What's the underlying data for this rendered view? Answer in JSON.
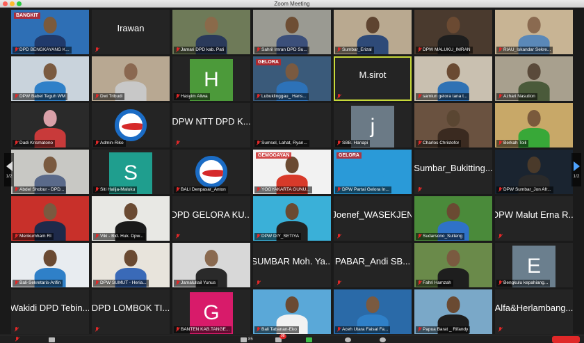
{
  "window": {
    "title": "Zoom Meeting"
  },
  "pager": {
    "left_page": "1/2",
    "right_page": "1/2"
  },
  "toolbar": {
    "participants_count": "85",
    "chat_badge": "98"
  },
  "tiles": [
    {
      "name": "DPD BENGKAYANG K...",
      "kind": "video",
      "bg": "#2e6fb5",
      "head": "#7a5a3c",
      "body": "#203a6b",
      "banner": "BANGKIT"
    },
    {
      "name": "",
      "kind": "text",
      "big": "Irawan"
    },
    {
      "name": "Jamari DPD kab. Pati",
      "kind": "video",
      "bg": "#6e7a58",
      "head": "#8a6a4a",
      "body": "#2a3a5a"
    },
    {
      "name": "Sahril Imran DPD Su...",
      "kind": "video",
      "bg": "#9a9a92",
      "head": "#6e4e34",
      "body": "#3b4f7a"
    },
    {
      "name": "Sumbar_Erizal",
      "kind": "video",
      "bg": "#b9a990",
      "head": "#5e4430",
      "body": "#2e4a78"
    },
    {
      "name": "DPW MALUKU_IMRAN",
      "kind": "video",
      "bg": "#4a3a2e",
      "head": "#6b4a32",
      "body": "#1e1e1e"
    },
    {
      "name": "RIAU_Iskandar Sekre...",
      "kind": "video",
      "bg": "#c8b494",
      "head": "#8a6a50",
      "body": "#5a88b8"
    },
    {
      "name": "DPW Babel Teguh WM",
      "kind": "video",
      "bg": "#c9d3dc",
      "head": "#7a5a40",
      "body": "#2f80c8"
    },
    {
      "name": "Dwi Tribudi",
      "kind": "video",
      "bg": "#b8a892",
      "head": "#8a6850",
      "body": "#c8c8c8"
    },
    {
      "name": "Hasyim Aliwa",
      "kind": "avatar",
      "avatar_letter": "H",
      "avatar_bg": "#4c9a3a"
    },
    {
      "name": "Lubuklinggau_ Hans...",
      "kind": "video",
      "bg": "#3a5a7a",
      "head": "#7a5a40",
      "body": "#2d72b8",
      "banner": "GELORA"
    },
    {
      "name": "",
      "kind": "text",
      "big": "M.sirot",
      "active": true
    },
    {
      "name": "samiun gelora tana t...",
      "kind": "video",
      "bg": "#c9c0b0",
      "head": "#6a4a32",
      "body": "#2f72b4"
    },
    {
      "name": "Azhari Nasution",
      "kind": "video",
      "bg": "#a8a08e",
      "head": "#5a4a3a",
      "body": "#4a5a3a"
    },
    {
      "name": "Dadi Krismatono",
      "kind": "video",
      "bg": "#2a2a2a",
      "head": "#d9a0a8",
      "body": "#c83a3a"
    },
    {
      "name": "Admin-Riko",
      "kind": "logo"
    },
    {
      "name": "",
      "kind": "text",
      "big": "DPW NTT DPD K..."
    },
    {
      "name": "Sumsel, Lahat, Ryan...",
      "kind": "blank"
    },
    {
      "name": "SBB. Hanapi",
      "kind": "avatar",
      "avatar_letter": "j",
      "avatar_bg": "#6b7a86"
    },
    {
      "name": "Charlos Christofor",
      "kind": "video",
      "bg": "#6a5240",
      "head": "#5a4632",
      "body": "#3a2a20"
    },
    {
      "name": "Berkah Toili",
      "kind": "video",
      "bg": "#c8a868",
      "head": "#7a5a3c",
      "body": "#38a838"
    },
    {
      "name": "Abdel Shobur - DPD...",
      "kind": "video",
      "bg": "#c8c8c4",
      "head": "#7a5a40",
      "body": "#5a6a8a"
    },
    {
      "name": "Siti Halija-Maluku",
      "kind": "avatar",
      "avatar_letter": "S",
      "avatar_bg": "#1f9e8e"
    },
    {
      "name": "BALI Denpasar_Anton",
      "kind": "logo"
    },
    {
      "name": "YOGYAKARTA GUNU...",
      "kind": "video",
      "bg": "#f2f2f2",
      "head": "#6a4a32",
      "body": "#d83a2a",
      "banner": "GEMOGAYAN"
    },
    {
      "name": "DPW Partai Gelora In...",
      "kind": "video",
      "bg": "#2a9ad8",
      "head": "#2a9ad8",
      "body": "#2a9ad8",
      "banner": "GELORA"
    },
    {
      "name": "",
      "kind": "text",
      "big": "Sumbar_Bukitting..."
    },
    {
      "name": "DPW Sumbar_Jon Afr...",
      "kind": "video",
      "bg": "#1a2430",
      "head": "#4a3a2a",
      "body": "#2a2a2a"
    },
    {
      "name": "Menkumham RI",
      "kind": "video",
      "bg": "#c8302a",
      "head": "#7a5a40",
      "body": "#1e2a4a"
    },
    {
      "name": "Viki - Bid. Huk. Dpw...",
      "kind": "video",
      "bg": "#e8e8e4",
      "head": "#6a4a32",
      "body": "#1a1a1a"
    },
    {
      "name": "",
      "kind": "text",
      "big": "DPD GELORA KU..."
    },
    {
      "name": "DPW DIY_SETIYA",
      "kind": "video",
      "bg": "#3ab0d8",
      "head": "#6a4a32",
      "body": "#222222"
    },
    {
      "name": "",
      "kind": "text",
      "big": "Joenef_WASEKJEN"
    },
    {
      "name": "Sudarsono_Sulteng",
      "kind": "video",
      "bg": "#4a8a3a",
      "head": "#6a4a32",
      "body": "#2f72c8"
    },
    {
      "name": "",
      "kind": "text",
      "big": "DPW Malut Erna R..."
    },
    {
      "name": "Bali-Sekretaris-Arifin",
      "kind": "video",
      "bg": "#e8ecf0",
      "head": "#6a4a32",
      "body": "#2f80c8"
    },
    {
      "name": "DPW SUMUT - Heria...",
      "kind": "video",
      "bg": "#e8e4dc",
      "head": "#6a4a32",
      "body": "#3a6ab8"
    },
    {
      "name": "Jamalullail Yunus",
      "kind": "video",
      "bg": "#d8d8d8",
      "head": "#8a6a50",
      "body": "#2a2a2a"
    },
    {
      "name": "",
      "kind": "text",
      "big": "SUMBAR Moh. Ya..."
    },
    {
      "name": "",
      "kind": "text",
      "big": "PABAR_Andi SB..."
    },
    {
      "name": "Fahri Hamzah",
      "kind": "video",
      "bg": "#6a8a4a",
      "head": "#7a5a40",
      "body": "#1e1e1e"
    },
    {
      "name": "Bengkulu kepahiang...",
      "kind": "avatar",
      "avatar_letter": "E",
      "avatar_bg": "#6b7f8e"
    },
    {
      "name": "",
      "kind": "text",
      "big": "Wakidi DPD Tebin..."
    },
    {
      "name": "",
      "kind": "text",
      "big": "DPD LOMBOK TI..."
    },
    {
      "name": "BANTEN KAB.TANGE...",
      "kind": "avatar",
      "avatar_letter": "G",
      "avatar_bg": "#d81b6a"
    },
    {
      "name": "Bali Tabanan-Eko",
      "kind": "video",
      "bg": "#5aa8d8",
      "head": "#6a4a32",
      "body": "#f2f2f2"
    },
    {
      "name": "Aceh Utara Faisal Fa...",
      "kind": "video",
      "bg": "#2a6aa8",
      "head": "#7a5a40",
      "body": "#2f80c8"
    },
    {
      "name": "Papua Barat _ Rifandy",
      "kind": "video",
      "bg": "#7aa8c8",
      "head": "#6a4a32",
      "body": "#1e1e1e"
    },
    {
      "name": "",
      "kind": "text",
      "big": "Alfa&Herlambang..."
    }
  ]
}
